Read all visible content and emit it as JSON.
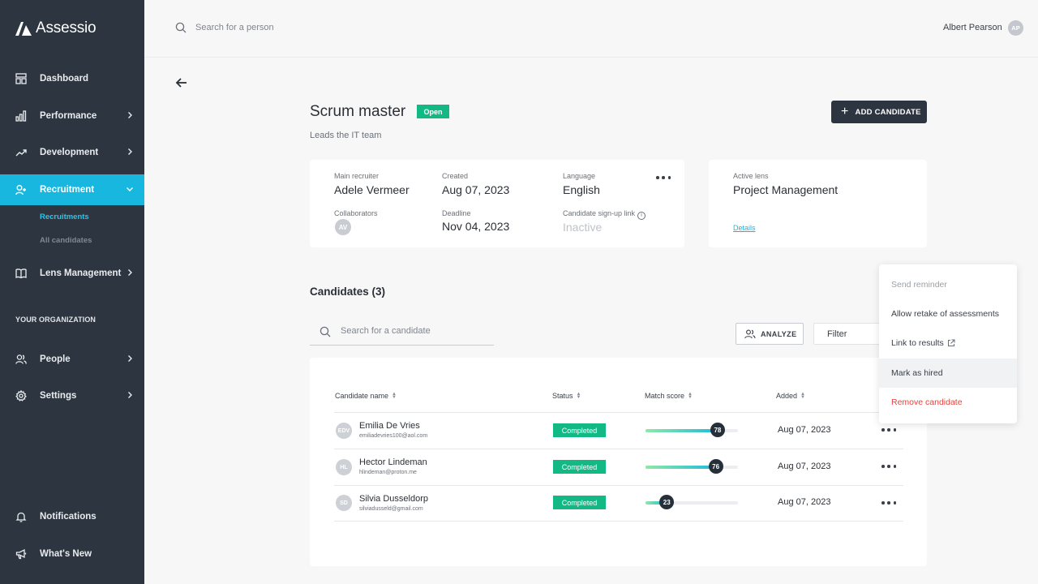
{
  "app": {
    "name": "Assessio"
  },
  "sidebar": {
    "items": [
      {
        "label": "Dashboard"
      },
      {
        "label": "Performance"
      },
      {
        "label": "Development"
      },
      {
        "label": "Recruitment"
      },
      {
        "label": "Lens Management"
      },
      {
        "label": "People"
      },
      {
        "label": "Settings"
      },
      {
        "label": "Notifications"
      },
      {
        "label": "What's New"
      }
    ],
    "recruitment_sub": [
      "Recruitments",
      "All candidates"
    ],
    "section_label": "YOUR ORGANIZATION",
    "accent_color": "#18b7e0"
  },
  "topbar": {
    "search_placeholder": "Search for a person",
    "user_name": "Albert Pearson",
    "user_initials": "AP"
  },
  "recruitment": {
    "title": "Scrum master",
    "status": "Open",
    "description": "Leads the IT team",
    "add_candidate_label": "ADD CANDIDATE",
    "info": {
      "main_recruiter_label": "Main recruiter",
      "main_recruiter": "Adele Vermeer",
      "created_label": "Created",
      "created": "Aug 07, 2023",
      "language_label": "Language",
      "language": "English",
      "collaborators_label": "Collaborators",
      "collaborator_initials": "AV",
      "deadline_label": "Deadline",
      "deadline": "Nov 04, 2023",
      "signup_link_label": "Candidate sign-up link",
      "signup_link_value": "Inactive"
    },
    "lens": {
      "label": "Active lens",
      "value": "Project Management",
      "details_link": "Details"
    }
  },
  "candidates": {
    "heading": "Candidates (3)",
    "search_placeholder": "Search for a candidate",
    "analyze_label": "ANALYZE",
    "filter_label": "Filter",
    "columns": [
      "Candidate name",
      "Status",
      "Match score",
      "Added"
    ],
    "rows": [
      {
        "initials": "EDV",
        "name": "Emilia De Vries",
        "email": "emiliadevries100@aol.com",
        "status": "Completed",
        "score": 78,
        "score_text": "78",
        "added": "Aug 07, 2023"
      },
      {
        "initials": "HL",
        "name": "Hector Lindeman",
        "email": "hlindeman@proton.me",
        "status": "Completed",
        "score": 76,
        "score_text": "76",
        "added": "Aug 07, 2023"
      },
      {
        "initials": "SD",
        "name": "Silvia Dusseldorp",
        "email": "silviadusseld@gmail.com",
        "status": "Completed",
        "score": 23,
        "score_text": "23",
        "added": "Aug 07, 2023"
      }
    ]
  },
  "row_menu": {
    "items": [
      {
        "label": "Send reminder",
        "state": "disabled"
      },
      {
        "label": "Allow retake of assessments",
        "state": "normal"
      },
      {
        "label": "Link to results",
        "state": "normal"
      },
      {
        "label": "Mark as hired",
        "state": "hover"
      },
      {
        "label": "Remove candidate",
        "state": "danger"
      }
    ]
  },
  "colors": {
    "status_green": "#13b985",
    "sidebar_bg": "#2d3540",
    "danger": "#e8413a"
  }
}
